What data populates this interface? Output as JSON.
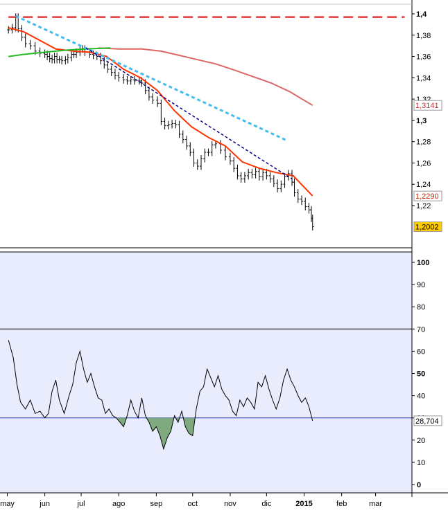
{
  "chart_data": [
    {
      "type": "line",
      "title": "",
      "ylim": [
        1.19,
        1.4
      ],
      "yticks": [
        "1,4",
        "1,38",
        "1,36",
        "1,34",
        "1,32",
        "1,3",
        "1,28",
        "1,26",
        "1,24",
        "1,22"
      ],
      "ytick_values": [
        1.4,
        1.38,
        1.36,
        1.34,
        1.32,
        1.3,
        1.28,
        1.26,
        1.24,
        1.22
      ],
      "series": [
        {
          "style": "ohlc-bars",
          "color": "#000000",
          "points": [
            [
              "2014-05-02",
              1.385
            ],
            [
              "2014-05-05",
              1.387
            ],
            [
              "2014-05-08",
              1.397
            ],
            [
              "2014-05-10",
              1.386
            ],
            [
              "2014-05-13",
              1.378
            ],
            [
              "2014-05-16",
              1.372
            ],
            [
              "2014-05-20",
              1.37
            ],
            [
              "2014-05-24",
              1.365
            ],
            [
              "2014-05-28",
              1.363
            ],
            [
              "2014-06-01",
              1.362
            ],
            [
              "2014-06-03",
              1.36
            ],
            [
              "2014-06-05",
              1.358
            ],
            [
              "2014-06-07",
              1.357
            ],
            [
              "2014-06-09",
              1.36
            ],
            [
              "2014-06-11",
              1.357
            ],
            [
              "2014-06-13",
              1.357
            ],
            [
              "2014-06-15",
              1.356
            ],
            [
              "2014-06-18",
              1.357
            ],
            [
              "2014-06-20",
              1.359
            ],
            [
              "2014-06-23",
              1.362
            ],
            [
              "2014-06-25",
              1.362
            ],
            [
              "2014-06-27",
              1.364
            ],
            [
              "2014-06-30",
              1.367
            ],
            [
              "2014-07-02",
              1.367
            ],
            [
              "2014-07-04",
              1.364
            ],
            [
              "2014-07-08",
              1.362
            ],
            [
              "2014-07-11",
              1.361
            ],
            [
              "2014-07-14",
              1.36
            ],
            [
              "2014-07-17",
              1.356
            ],
            [
              "2014-07-20",
              1.352
            ],
            [
              "2014-07-23",
              1.348
            ],
            [
              "2014-07-26",
              1.345
            ],
            [
              "2014-07-29",
              1.342
            ],
            [
              "2014-08-01",
              1.34
            ],
            [
              "2014-08-05",
              1.338
            ],
            [
              "2014-08-08",
              1.337
            ],
            [
              "2014-08-11",
              1.338
            ],
            [
              "2014-08-14",
              1.337
            ],
            [
              "2014-08-18",
              1.337
            ],
            [
              "2014-08-20",
              1.335
            ],
            [
              "2014-08-23",
              1.328
            ],
            [
              "2014-08-26",
              1.322
            ],
            [
              "2014-08-29",
              1.319
            ],
            [
              "2014-09-02",
              1.316
            ],
            [
              "2014-09-05",
              1.299
            ],
            [
              "2014-09-08",
              1.295
            ],
            [
              "2014-09-11",
              1.296
            ],
            [
              "2014-09-14",
              1.297
            ],
            [
              "2014-09-17",
              1.296
            ],
            [
              "2014-09-20",
              1.287
            ],
            [
              "2014-09-23",
              1.282
            ],
            [
              "2014-09-26",
              1.276
            ],
            [
              "2014-09-29",
              1.27
            ],
            [
              "2014-10-02",
              1.26
            ],
            [
              "2014-10-05",
              1.257
            ],
            [
              "2014-10-08",
              1.264
            ],
            [
              "2014-10-11",
              1.27
            ],
            [
              "2014-10-14",
              1.27
            ],
            [
              "2014-10-17",
              1.277
            ],
            [
              "2014-10-20",
              1.278
            ],
            [
              "2014-10-24",
              1.272
            ],
            [
              "2014-10-28",
              1.266
            ],
            [
              "2014-11-01",
              1.262
            ],
            [
              "2014-11-04",
              1.255
            ],
            [
              "2014-11-07",
              1.248
            ],
            [
              "2014-11-10",
              1.245
            ],
            [
              "2014-11-13",
              1.248
            ],
            [
              "2014-11-16",
              1.251
            ],
            [
              "2014-11-19",
              1.249
            ],
            [
              "2014-11-22",
              1.252
            ],
            [
              "2014-11-25",
              1.247
            ],
            [
              "2014-11-28",
              1.251
            ],
            [
              "2014-12-01",
              1.248
            ],
            [
              "2014-12-04",
              1.245
            ],
            [
              "2014-12-07",
              1.241
            ],
            [
              "2014-12-10",
              1.236
            ],
            [
              "2014-12-13",
              1.24
            ],
            [
              "2014-12-16",
              1.247
            ],
            [
              "2014-12-19",
              1.25
            ],
            [
              "2014-12-22",
              1.242
            ],
            [
              "2014-12-24",
              1.232
            ],
            [
              "2014-12-27",
              1.226
            ],
            [
              "2014-12-30",
              1.224
            ],
            [
              "2015-01-02",
              1.219
            ],
            [
              "2015-01-05",
              1.216
            ],
            [
              "2015-01-07",
              1.208
            ],
            [
              "2015-01-08",
              1.2002
            ]
          ]
        },
        {
          "style": "line",
          "color": "#ff3300",
          "points": [
            [
              "2014-05-02",
              1.387
            ],
            [
              "2014-05-15",
              1.383
            ],
            [
              "2014-05-28",
              1.375
            ],
            [
              "2014-06-10",
              1.367
            ],
            [
              "2014-06-25",
              1.365
            ],
            [
              "2014-07-08",
              1.364
            ],
            [
              "2014-07-22",
              1.36
            ],
            [
              "2014-08-05",
              1.348
            ],
            [
              "2014-08-19",
              1.34
            ],
            [
              "2014-09-02",
              1.328
            ],
            [
              "2014-09-16",
              1.309
            ],
            [
              "2014-09-30",
              1.294
            ],
            [
              "2014-10-14",
              1.284
            ],
            [
              "2014-10-28",
              1.276
            ],
            [
              "2014-11-11",
              1.261
            ],
            [
              "2014-11-25",
              1.255
            ],
            [
              "2014-12-09",
              1.251
            ],
            [
              "2014-12-23",
              1.248
            ],
            [
              "2015-01-08",
              1.229
            ]
          ]
        },
        {
          "style": "line",
          "color": "#dd6666",
          "points": [
            [
              "2014-07-15",
              1.368
            ],
            [
              "2014-08-01",
              1.367
            ],
            [
              "2014-08-20",
              1.367
            ],
            [
              "2014-09-05",
              1.365
            ],
            [
              "2014-09-20",
              1.361
            ],
            [
              "2014-10-05",
              1.357
            ],
            [
              "2014-10-20",
              1.353
            ],
            [
              "2014-11-05",
              1.347
            ],
            [
              "2014-11-20",
              1.341
            ],
            [
              "2014-12-05",
              1.335
            ],
            [
              "2014-12-20",
              1.327
            ],
            [
              "2015-01-08",
              1.3141
            ]
          ]
        },
        {
          "style": "line",
          "color": "#22bb22",
          "points": [
            [
              "2014-05-02",
              1.36
            ],
            [
              "2014-05-15",
              1.362
            ],
            [
              "2014-06-01",
              1.364
            ],
            [
              "2014-06-20",
              1.366
            ],
            [
              "2014-07-05",
              1.367
            ],
            [
              "2014-07-25",
              1.368
            ]
          ]
        },
        {
          "style": "dashed",
          "color": "#dd0000",
          "points": [
            [
              "2014-05-02",
              1.397
            ],
            [
              "2015-03-25",
              1.397
            ]
          ]
        },
        {
          "style": "dashed",
          "color": "#44bbee",
          "points": [
            [
              "2014-05-08",
              1.398
            ],
            [
              "2014-12-18",
              1.281
            ]
          ]
        },
        {
          "style": "dashed",
          "color": "#000088",
          "points": [
            [
              "2014-07-05",
              1.368
            ],
            [
              "2014-12-22",
              1.245
            ]
          ]
        }
      ],
      "value_labels": [
        {
          "text": "1,3141",
          "value": 1.3141,
          "color": "#cc3333",
          "bg": "#ffffff"
        },
        {
          "text": "1,2290",
          "value": 1.229,
          "color": "#cc2200",
          "bg": "#ffffff"
        },
        {
          "text": "1,2002",
          "value": 1.2002,
          "color": "#000000",
          "bg": "#ffcc00"
        }
      ]
    },
    {
      "type": "line",
      "title": "",
      "ylim": [
        -5,
        105
      ],
      "yticks": [
        "100",
        "90",
        "80",
        "70",
        "60",
        "50",
        "40",
        "30",
        "20",
        "10",
        "0"
      ],
      "ytick_values": [
        100,
        90,
        80,
        70,
        60,
        50,
        40,
        30,
        20,
        10,
        0
      ],
      "reference_lines": [
        70,
        30
      ],
      "shade_below": 30,
      "series": [
        {
          "style": "line",
          "color": "#000000",
          "points": [
            [
              "2014-05-02",
              65
            ],
            [
              "2014-05-06",
              57
            ],
            [
              "2014-05-09",
              45
            ],
            [
              "2014-05-12",
              37
            ],
            [
              "2014-05-16",
              34
            ],
            [
              "2014-05-20",
              38
            ],
            [
              "2014-05-24",
              32
            ],
            [
              "2014-05-28",
              33
            ],
            [
              "2014-06-01",
              30
            ],
            [
              "2014-06-04",
              32
            ],
            [
              "2014-06-07",
              42
            ],
            [
              "2014-06-10",
              47
            ],
            [
              "2014-06-13",
              38
            ],
            [
              "2014-06-17",
              32
            ],
            [
              "2014-06-21",
              40
            ],
            [
              "2014-06-24",
              45
            ],
            [
              "2014-06-27",
              55
            ],
            [
              "2014-06-30",
              60
            ],
            [
              "2014-07-03",
              52
            ],
            [
              "2014-07-06",
              46
            ],
            [
              "2014-07-09",
              50
            ],
            [
              "2014-07-12",
              44
            ],
            [
              "2014-07-15",
              39
            ],
            [
              "2014-07-18",
              38
            ],
            [
              "2014-07-21",
              32
            ],
            [
              "2014-07-24",
              34
            ],
            [
              "2014-07-27",
              31
            ],
            [
              "2014-07-30",
              30
            ],
            [
              "2014-08-02",
              28
            ],
            [
              "2014-08-05",
              26
            ],
            [
              "2014-08-08",
              31
            ],
            [
              "2014-08-11",
              38
            ],
            [
              "2014-08-14",
              33
            ],
            [
              "2014-08-17",
              30
            ],
            [
              "2014-08-20",
              39
            ],
            [
              "2014-08-23",
              31
            ],
            [
              "2014-08-26",
              28
            ],
            [
              "2014-08-29",
              24
            ],
            [
              "2014-09-01",
              26
            ],
            [
              "2014-09-04",
              22
            ],
            [
              "2014-09-07",
              16
            ],
            [
              "2014-09-10",
              21
            ],
            [
              "2014-09-13",
              24
            ],
            [
              "2014-09-16",
              31
            ],
            [
              "2014-09-19",
              28
            ],
            [
              "2014-09-22",
              33
            ],
            [
              "2014-09-25",
              26
            ],
            [
              "2014-09-28",
              23
            ],
            [
              "2014-10-01",
              22
            ],
            [
              "2014-10-04",
              34
            ],
            [
              "2014-10-07",
              42
            ],
            [
              "2014-10-10",
              44
            ],
            [
              "2014-10-13",
              52
            ],
            [
              "2014-10-16",
              48
            ],
            [
              "2014-10-19",
              44
            ],
            [
              "2014-10-22",
              49
            ],
            [
              "2014-10-25",
              43
            ],
            [
              "2014-10-28",
              40
            ],
            [
              "2014-10-31",
              38
            ],
            [
              "2014-11-03",
              33
            ],
            [
              "2014-11-06",
              31
            ],
            [
              "2014-11-09",
              38
            ],
            [
              "2014-11-12",
              35
            ],
            [
              "2014-11-15",
              39
            ],
            [
              "2014-11-18",
              37
            ],
            [
              "2014-11-21",
              34
            ],
            [
              "2014-11-24",
              46
            ],
            [
              "2014-11-27",
              44
            ],
            [
              "2014-11-30",
              49
            ],
            [
              "2014-12-03",
              43
            ],
            [
              "2014-12-06",
              38
            ],
            [
              "2014-12-09",
              34
            ],
            [
              "2014-12-12",
              39
            ],
            [
              "2014-12-15",
              47
            ],
            [
              "2014-12-18",
              52
            ],
            [
              "2014-12-21",
              47
            ],
            [
              "2014-12-24",
              44
            ],
            [
              "2014-12-27",
              40
            ],
            [
              "2014-12-30",
              37
            ],
            [
              "2015-01-02",
              39
            ],
            [
              "2015-01-05",
              35
            ],
            [
              "2015-01-08",
              28.704
            ]
          ]
        }
      ],
      "value_labels": [
        {
          "text": "28,704",
          "value": 28.704,
          "color": "#000000",
          "bg": "#ffffff"
        }
      ]
    }
  ],
  "x_axis": {
    "range": [
      "2014-04-25",
      "2015-03-31"
    ],
    "ticks": [
      {
        "label": "may",
        "date": "2014-05-01",
        "bold": false
      },
      {
        "label": "jun",
        "date": "2014-06-01",
        "bold": false
      },
      {
        "label": "jul",
        "date": "2014-07-01",
        "bold": false
      },
      {
        "label": "ago",
        "date": "2014-08-01",
        "bold": false
      },
      {
        "label": "sep",
        "date": "2014-09-01",
        "bold": false
      },
      {
        "label": "oct",
        "date": "2014-10-01",
        "bold": false
      },
      {
        "label": "nov",
        "date": "2014-11-01",
        "bold": false
      },
      {
        "label": "dic",
        "date": "2014-12-01",
        "bold": false
      },
      {
        "label": "2015",
        "date": "2015-01-01",
        "bold": true
      },
      {
        "label": "feb",
        "date": "2015-02-01",
        "bold": false
      },
      {
        "label": "mar",
        "date": "2015-03-01",
        "bold": false
      }
    ]
  },
  "colors": {
    "panel_bg": "#ffffff",
    "indicator_bg": "#e8ecfc",
    "oversold_fill": "#7faa7f",
    "axis": "#000000"
  }
}
